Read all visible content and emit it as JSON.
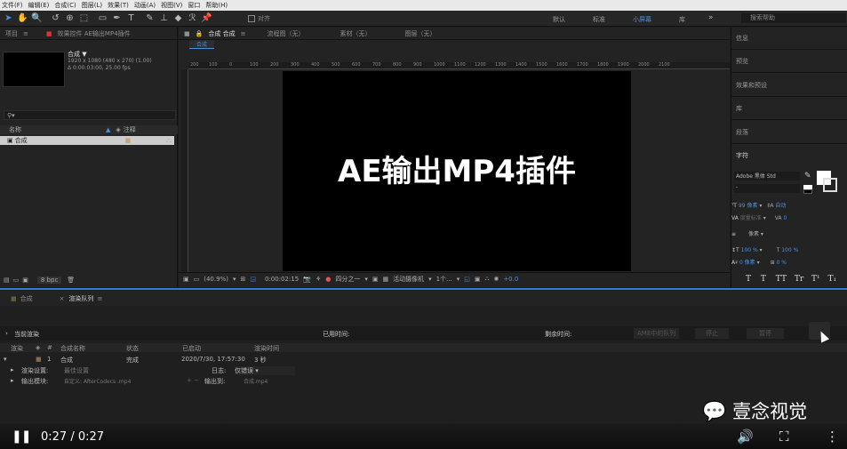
{
  "menu": [
    "文件(F)",
    "编辑(E)",
    "合成(C)",
    "图层(L)",
    "效果(T)",
    "动画(A)",
    "视图(V)",
    "窗口",
    "帮助(H)"
  ],
  "toolbar": {
    "align": "对齐",
    "workspaces": [
      "默认",
      "标准",
      "小屏幕",
      "库"
    ],
    "search_placeholder": "搜索帮助"
  },
  "project": {
    "tab_project": "项目",
    "tab_effects": "效果控件 AE输出MP4插件",
    "comp_name": "合成 ▼",
    "comp_res": "1920 x 1080 (480 x 270) (1.00)",
    "comp_dur": "Δ 0:00:03:00, 25.00 fps",
    "col_name": "名称",
    "col_comment": "注释",
    "row_name": "合成",
    "bpc": "8 bpc"
  },
  "viewer": {
    "tab_comp": "合成 合成",
    "tab_flow": "流程图（无）",
    "tab_footage": "素材（无）",
    "tab_layer": "图层（无）",
    "subtab": "合成",
    "ruler_ticks": [
      "200",
      "100",
      "0",
      "100",
      "200",
      "300",
      "400",
      "500",
      "600",
      "700",
      "800",
      "900",
      "1000",
      "1100",
      "1200",
      "1300",
      "1400",
      "1500",
      "1600",
      "1700",
      "1800",
      "1900",
      "2000",
      "2100"
    ],
    "comp_text": "AE输出MP4插件",
    "zoom": "(40.9%)",
    "timecode": "0:00:02:15",
    "resolution": "四分之一",
    "camera": "活动摄像机",
    "views": "1个...",
    "offset": "+0.0"
  },
  "right": {
    "items": [
      "信息",
      "预览",
      "效果和预设",
      "库",
      "段落",
      "字符"
    ],
    "font": "Adobe 黑体 Std",
    "font_style": "-",
    "size": "99 像素",
    "leading": "自动",
    "kerning": "度量标准",
    "tracking": "0",
    "stroke": "像素",
    "vscale": "100 %",
    "hscale": "100 %",
    "baseline": "0 像素",
    "tsume": "0 %",
    "styles": [
      "T",
      "T",
      "TT",
      "Tr",
      "T¹",
      "T₁"
    ]
  },
  "bottom": {
    "tab_comp": "合成",
    "tab_queue": "渲染队列",
    "current": "当前渲染",
    "elapsed": "已用时间:",
    "remaining": "剩余时间:",
    "ame": "AME中的队列",
    "stop": "停止",
    "pause": "暂停",
    "cols": [
      "渲染",
      "#",
      "合成名称",
      "状态",
      "已启动",
      "渲染时间"
    ],
    "row": {
      "index": "1",
      "name": "合成",
      "status": "完成",
      "started": "2020/7/30, 17:57:30",
      "time": "3 秒"
    },
    "settings_label": "渲染设置:",
    "settings_value": "最佳设置",
    "log_label": "日志:",
    "log_value": "仅错误",
    "output_module_label": "输出模块:",
    "output_module_value": "自定义: AfterCodecs .mp4",
    "output_to_label": "输出到:",
    "output_to_value": "合成.mp4"
  },
  "player": {
    "time": "0:27 / 0:27",
    "watermark": "壹念视觉"
  }
}
